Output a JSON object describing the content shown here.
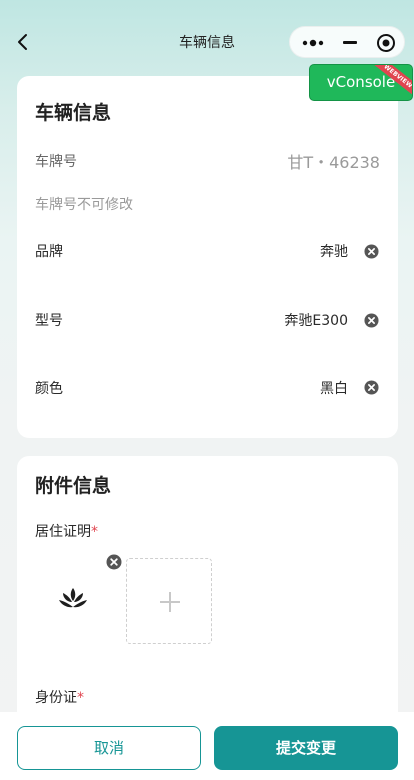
{
  "nav": {
    "title": "车辆信息"
  },
  "vconsole": {
    "label": "vConsole",
    "ribbon": "WEBVIEW"
  },
  "vehicle": {
    "section_title": "车辆信息",
    "plate_label": "车牌号",
    "plate_value": "甘T・46238",
    "plate_hint": "车牌号不可修改",
    "brand_label": "品牌",
    "brand_value": "奔驰",
    "model_label": "型号",
    "model_value": "奔驰E300",
    "color_label": "颜色",
    "color_value": "黑白"
  },
  "attachments": {
    "section_title": "附件信息",
    "residence_label": "居住证明",
    "id_label": "身份证",
    "required_mark": "*"
  },
  "actions": {
    "cancel_label": "取消",
    "submit_label": "提交变更"
  },
  "colors": {
    "primary": "#169595",
    "required": "#e0454f",
    "vconsole": "#1fb85a"
  }
}
